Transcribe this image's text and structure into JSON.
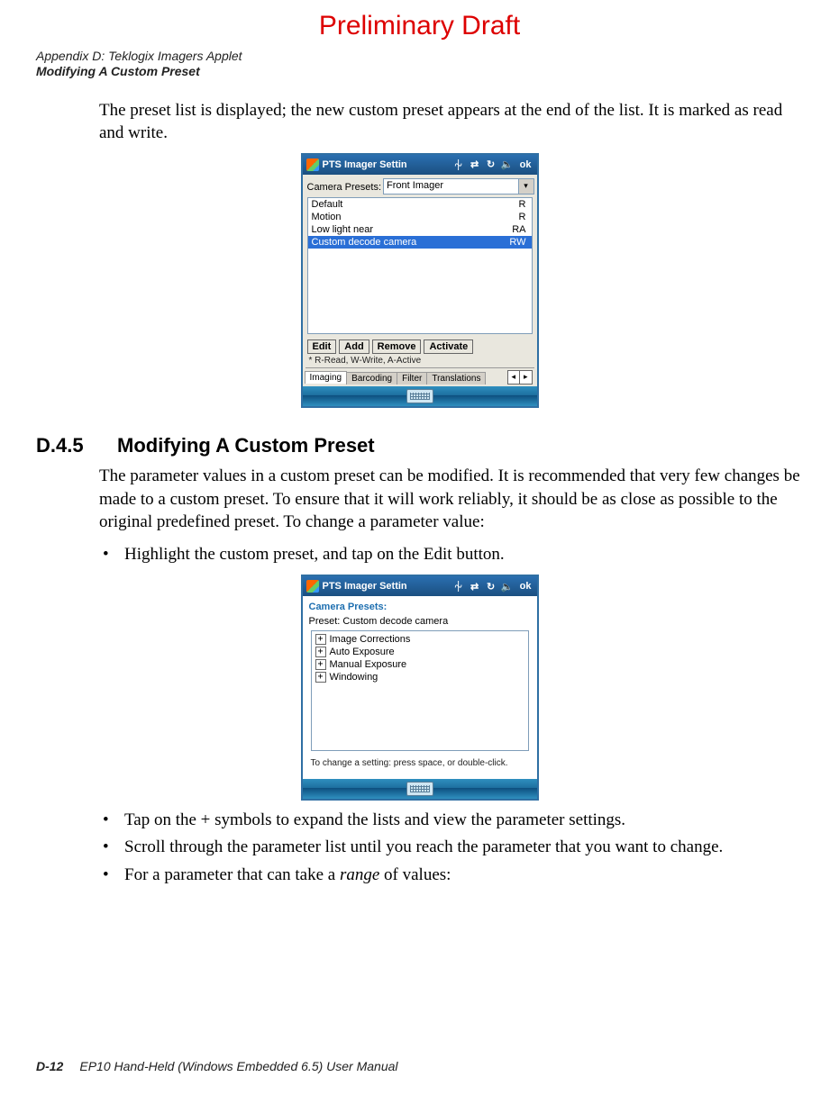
{
  "watermark": "Preliminary Draft",
  "header": {
    "appendix": "Appendix D:  Teklogix Imagers Applet",
    "section": "Modifying A Custom Preset"
  },
  "intro_para": "The preset list is displayed; the new custom preset appears at the end of the list. It is marked as read and write.",
  "shot1": {
    "title": "PTS Imager Settin",
    "ok": "ok",
    "camera_presets_label": "Camera Presets:",
    "camera_presets_value": "Front Imager",
    "rows": [
      {
        "name": "Default",
        "flag": "R"
      },
      {
        "name": "Motion",
        "flag": "R"
      },
      {
        "name": "Low light near",
        "flag": "RA"
      },
      {
        "name": "Custom decode camera",
        "flag": "RW"
      }
    ],
    "buttons": {
      "edit": "Edit",
      "add": "Add",
      "remove": "Remove",
      "activate": "Activate"
    },
    "legend": "* R-Read, W-Write, A-Active",
    "tabs": {
      "imaging": "Imaging",
      "barcoding": "Barcoding",
      "filter": "Filter",
      "translations": "Translations"
    }
  },
  "section": {
    "number": "D.4.5",
    "title": "Modifying A Custom Preset"
  },
  "para2": "The parameter values in a custom preset can be modified. It is recommended that very few changes be made to a custom preset. To ensure that it will work reliably, it should be as close as possible to the original predefined preset. To change a parameter value:",
  "bullets_before_shot2": [
    "Highlight the custom preset, and tap on the Edit button."
  ],
  "shot2": {
    "title": "PTS Imager Settin",
    "ok": "ok",
    "header": "Camera Presets:",
    "preset_label": "Preset:  Custom decode camera",
    "tree": [
      "Image Corrections",
      "Auto Exposure",
      "Manual Exposure",
      "Windowing"
    ],
    "hint": "To change a setting: press space, or double-click."
  },
  "bullets_after_shot2": [
    "Tap on the + symbols to expand the lists and view the parameter settings.",
    "Scroll through the parameter list until you reach the parameter that you want to change."
  ],
  "bullet_range_prefix": "For a parameter that can take a ",
  "bullet_range_em": "range",
  "bullet_range_suffix": " of values:",
  "footer": {
    "page": "D-12",
    "title": "EP10 Hand-Held (Windows Embedded 6.5) User Manual"
  }
}
